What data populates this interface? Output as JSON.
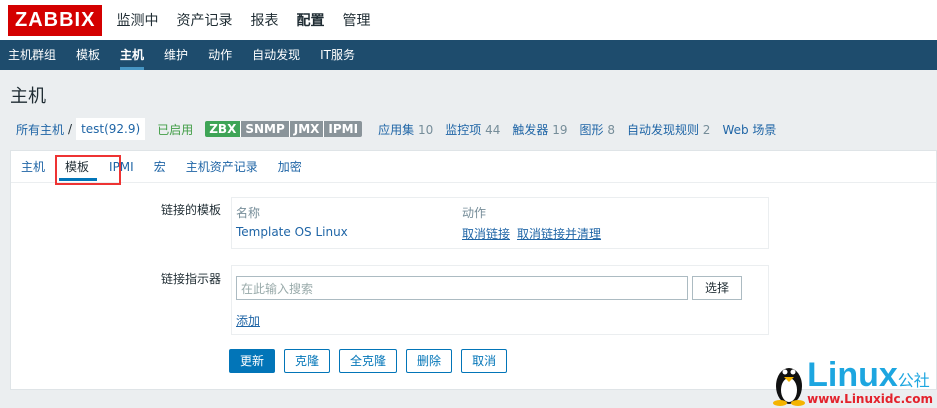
{
  "header": {
    "logo": "ZABBIX",
    "menu": [
      "监测中",
      "资产记录",
      "报表",
      "配置",
      "管理"
    ],
    "active": 3
  },
  "subnav": {
    "items": [
      "主机群组",
      "模板",
      "主机",
      "维护",
      "动作",
      "自动发现",
      "IT服务"
    ],
    "active": 2
  },
  "page_title": "主机",
  "hostbar": {
    "all_hosts": "所有主机",
    "separator": "/",
    "host": "test(92.9)",
    "status": "已启用",
    "tags": [
      "ZBX",
      "SNMP",
      "JMX",
      "IPMI"
    ],
    "links": [
      {
        "label": "应用集",
        "count": "10"
      },
      {
        "label": "监控项",
        "count": "44"
      },
      {
        "label": "触发器",
        "count": "19"
      },
      {
        "label": "图形",
        "count": "8"
      },
      {
        "label": "自动发现规则",
        "count": "2"
      },
      {
        "label": "Web 场景",
        "count": ""
      }
    ]
  },
  "tabs": [
    "主机",
    "模板",
    "IPMI",
    "宏",
    "主机资产记录",
    "加密"
  ],
  "form": {
    "linked_label": "链接的模板",
    "col_name": "名称",
    "col_action": "动作",
    "template": "Template OS Linux",
    "unlink": "取消链接",
    "unlink_clear": "取消链接并清理",
    "link_label": "链接指示器",
    "search_placeholder": "在此输入搜索",
    "select": "选择",
    "add": "添加"
  },
  "buttons": [
    "更新",
    "克隆",
    "全克隆",
    "删除",
    "取消"
  ],
  "watermark": {
    "brand": "Linux",
    "suffix": "公社",
    "url": "www.Linuxidc.com"
  }
}
